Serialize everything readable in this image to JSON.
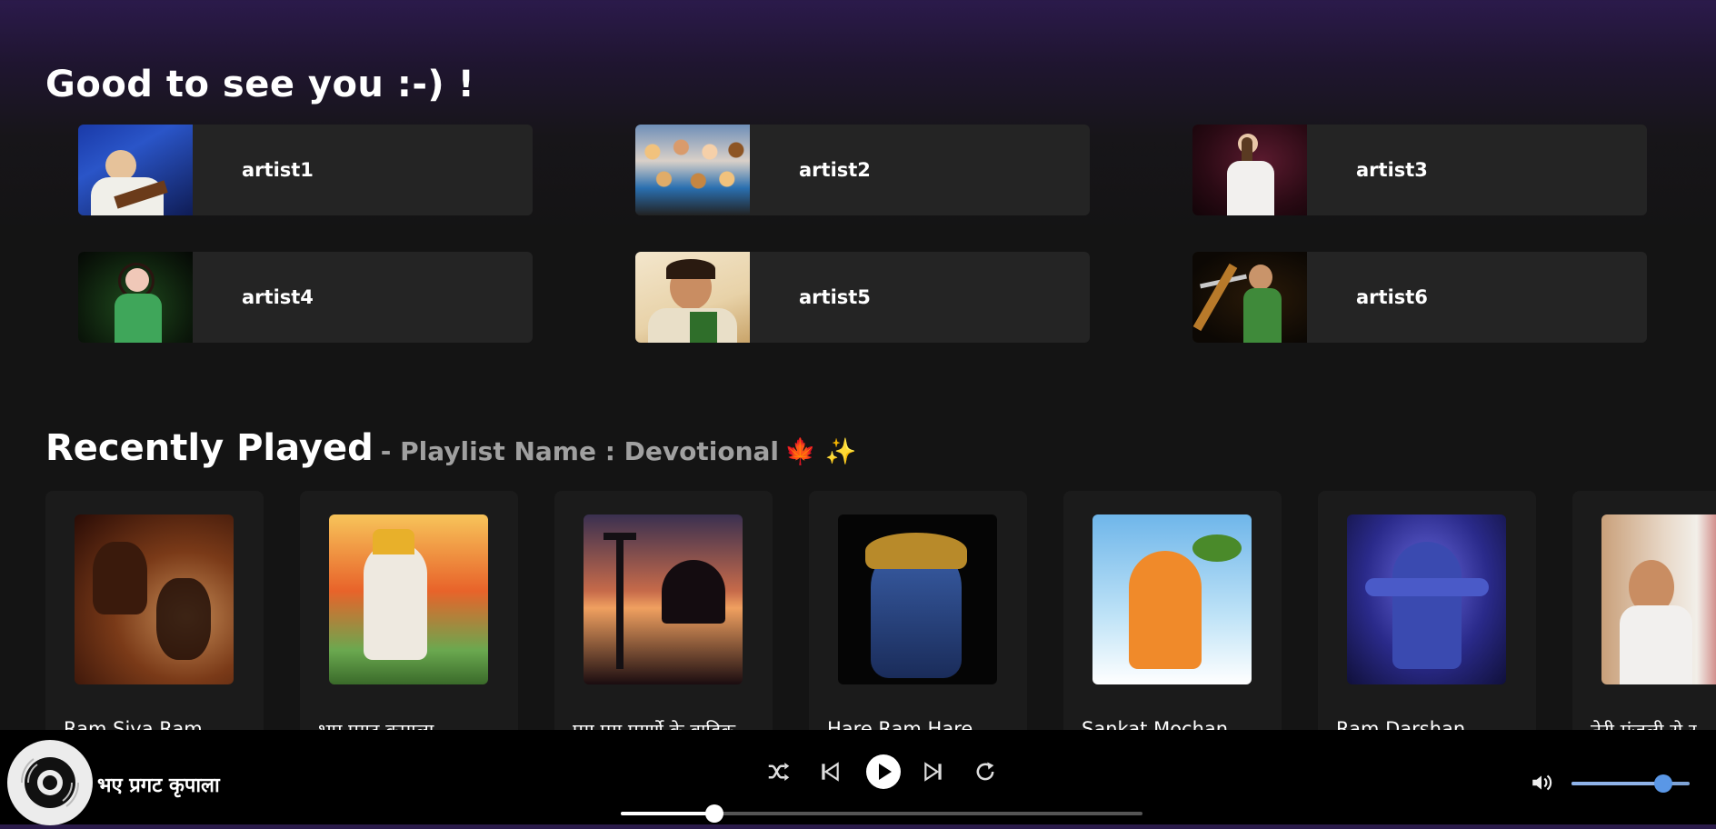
{
  "greeting": "Good to see you :-) !",
  "artists": [
    {
      "name": "artist1"
    },
    {
      "name": "artist2"
    },
    {
      "name": "artist3"
    },
    {
      "name": "artist4"
    },
    {
      "name": "artist5"
    },
    {
      "name": "artist6"
    }
  ],
  "recent": {
    "title": "Recently Played",
    "subtitle": "- Playlist Name : Devotional",
    "emoji": "🍁 ✨",
    "songs": [
      {
        "title": "Ram Siya Ram"
      },
      {
        "title": "भए प्रगट कृपाला"
      },
      {
        "title": "पग पग पगर्णे के वाहिक"
      },
      {
        "title": "Hare Ram Hare"
      },
      {
        "title": "Sankat Mochan"
      },
      {
        "title": "Ram Darshan"
      },
      {
        "title": "तेरी मंजली रो र"
      }
    ]
  },
  "player": {
    "now_playing": "भए प्रगट कृपाला",
    "progress": 0.18,
    "volume": 0.78,
    "controls": [
      "shuffle-icon",
      "previous-icon",
      "play-icon",
      "next-icon",
      "repeat-icon",
      "volume-icon"
    ]
  },
  "colors": {
    "accent": "#5a97e6",
    "card": "#242424",
    "background": "#141414"
  }
}
